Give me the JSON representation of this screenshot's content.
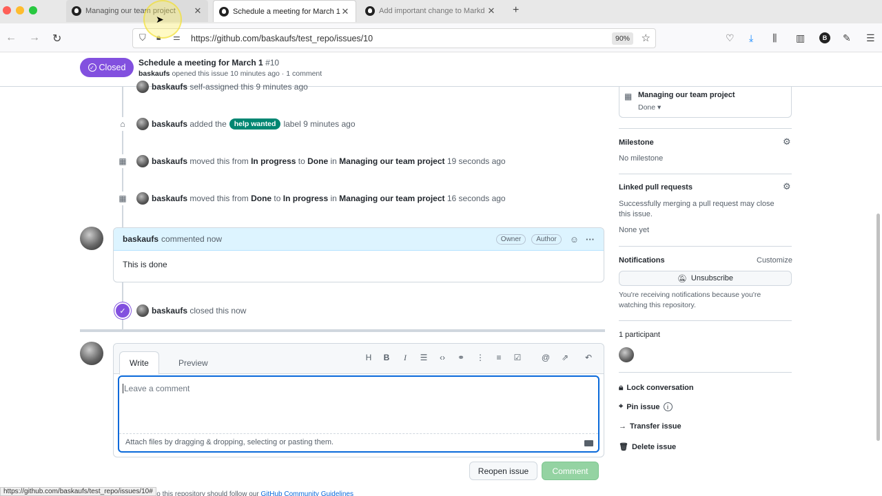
{
  "browser": {
    "tabs": [
      {
        "title": "Managing our team project"
      },
      {
        "title": "Schedule a meeting for March 1"
      },
      {
        "title": "Add important change to Markd"
      }
    ],
    "url": "https://github.com/baskaufs/test_repo/issues/10",
    "zoom": "90%",
    "profile_letter": "B",
    "status_url": "https://github.com/baskaufs/test_repo/issues/10#"
  },
  "issue": {
    "state": "Closed",
    "title": "Schedule a meeting for March 1",
    "number": "#10",
    "author": "baskaufs",
    "meta": "opened this issue 10 minutes ago · 1 comment"
  },
  "timeline": {
    "cut_event": {
      "user": "baskaufs",
      "text": "self-assigned this 9 minutes ago"
    },
    "label_event": {
      "user": "baskaufs",
      "before": "added the",
      "label": "help wanted",
      "after": "label 9 minutes ago"
    },
    "move1": {
      "user": "baskaufs",
      "t1": "moved this from",
      "from": "In progress",
      "t2": "to",
      "to": "Done",
      "t3": "in",
      "project": "Managing our team project",
      "time": "19 seconds ago"
    },
    "move2": {
      "user": "baskaufs",
      "t1": "moved this from",
      "from": "Done",
      "t2": "to",
      "to": "In progress",
      "t3": "in",
      "project": "Managing our team project",
      "time": "16 seconds ago"
    },
    "comment": {
      "user": "baskaufs",
      "time": "commented now",
      "badge_owner": "Owner",
      "badge_author": "Author",
      "body": "This is done"
    },
    "closed": {
      "user": "baskaufs",
      "text": "closed this now"
    }
  },
  "editor": {
    "tab_write": "Write",
    "tab_preview": "Preview",
    "toolbar": [
      "H",
      "B",
      "I"
    ],
    "placeholder": "Leave a comment",
    "attach": "Attach files by dragging & dropping, selecting or pasting them.",
    "reopen": "Reopen issue",
    "comment": "Comment",
    "footnote_prefix": "contributions to this repository should follow our",
    "footnote_link": "GitHub Community Guidelines"
  },
  "sidebar": {
    "project_name": "Managing our team project",
    "project_status": "Done",
    "milestone_heading": "Milestone",
    "milestone_value": "No milestone",
    "linked_heading": "Linked pull requests",
    "linked_text": "Successfully merging a pull request may close this issue.",
    "linked_value": "None yet",
    "notifications_heading": "Notifications",
    "customize": "Customize",
    "unsubscribe": "Unsubscribe",
    "notif_text": "You're receiving notifications because you're watching this repository.",
    "participants": "1 participant",
    "lock": "Lock conversation",
    "pin": "Pin issue",
    "transfer": "Transfer issue",
    "delete": "Delete issue"
  }
}
